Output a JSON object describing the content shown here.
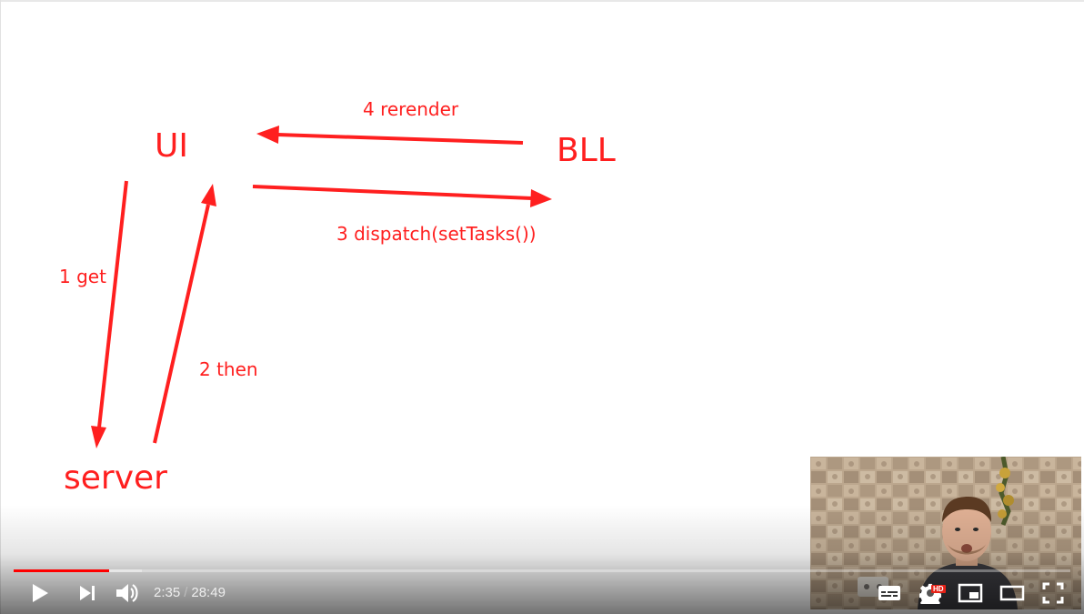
{
  "slide": {
    "labels": {
      "ui": "UI",
      "bll": "BLL",
      "server": "server",
      "step1": "1 get",
      "step2": "2 then",
      "step3": "3 dispatch(setTasks())",
      "step4": "4 rerender"
    },
    "color": "#ff1f1f"
  },
  "player": {
    "current_time": "2:35",
    "separator": "/",
    "duration": "28:49",
    "played_fraction": 0.0904,
    "buffered_fraction": 0.121,
    "accent": "#ff0000",
    "quality_badge": "HD",
    "icons": {
      "play": "play-icon",
      "next": "next-icon",
      "volume": "volume-icon",
      "subtitles": "subtitles-icon",
      "settings": "gear-icon",
      "miniplayer": "miniplayer-icon",
      "theater": "theater-mode-icon",
      "fullscreen": "fullscreen-icon"
    }
  }
}
